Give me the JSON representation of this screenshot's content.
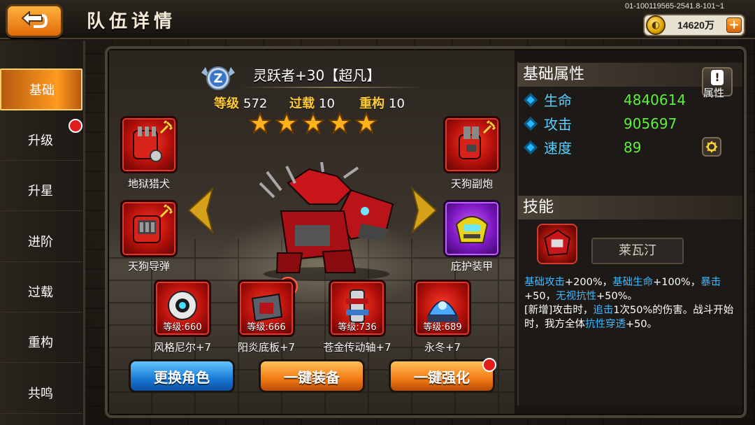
{
  "header": {
    "title": "队伍详情",
    "version": "01-100119565-2541.8-101~1",
    "currency_value": "14620万",
    "add_label": "+"
  },
  "sidebar": {
    "items": [
      {
        "label": "基础",
        "active": true
      },
      {
        "label": "升级",
        "dot": true
      },
      {
        "label": "升星"
      },
      {
        "label": "进阶"
      },
      {
        "label": "过载"
      },
      {
        "label": "重构"
      },
      {
        "label": "共鸣"
      }
    ]
  },
  "hero": {
    "rank_letter": "Z",
    "name": "灵跃者+30【超凡】",
    "level_label": "等级",
    "level_value": "572",
    "overload_label": "过载",
    "overload_value": "10",
    "rebuild_label": "重构",
    "rebuild_value": "10",
    "stars": 5
  },
  "equipment": {
    "top": [
      {
        "name": "地狱猎犬",
        "rarity": "red"
      },
      {
        "name": "天狗副炮",
        "rarity": "red"
      },
      {
        "name": "天狗导弹",
        "rarity": "red"
      },
      {
        "name": "庇护装甲",
        "rarity": "purple"
      }
    ],
    "bottom": [
      {
        "name": "风格尼尔+7",
        "level": "等级:660"
      },
      {
        "name": "阳炎底板+7",
        "level": "等级:666"
      },
      {
        "name": "苍金传动轴+7",
        "level": "等级:736"
      },
      {
        "name": "永冬+7",
        "level": "等级:689"
      }
    ]
  },
  "actions": {
    "change_role": "更换角色",
    "one_click_equip": "一键装备",
    "one_click_upgrade": "一键强化"
  },
  "attributes": {
    "section_title": "基础属性",
    "button_label": "属性",
    "button_icon": "!",
    "rows": [
      {
        "name": "生命",
        "value": "4840614"
      },
      {
        "name": "攻击",
        "value": "905697"
      },
      {
        "name": "速度",
        "value": "89"
      }
    ]
  },
  "skill": {
    "section_title": "技能",
    "name": "莱瓦汀",
    "desc": {
      "p1": "基础攻击",
      "p2": "+200%，",
      "p3": "基础生命",
      "p4": "+100%，",
      "p5": "暴击",
      "p6": "+50，",
      "p7": "无视抗性",
      "p8": "+50%。",
      "p9": "[新增]攻击时，",
      "p10": "追击",
      "p11": "1次50%的伤害。战斗开始时，我方全体",
      "p12": "抗性穿透",
      "p13": "+50。"
    }
  },
  "colors": {
    "accent_orange": "#f27a12",
    "blue_button": "#1a79d6",
    "attr_value_green": "#5ef03a",
    "attr_name_blue": "#5ad0ff",
    "notify_red": "#e21b1b"
  }
}
